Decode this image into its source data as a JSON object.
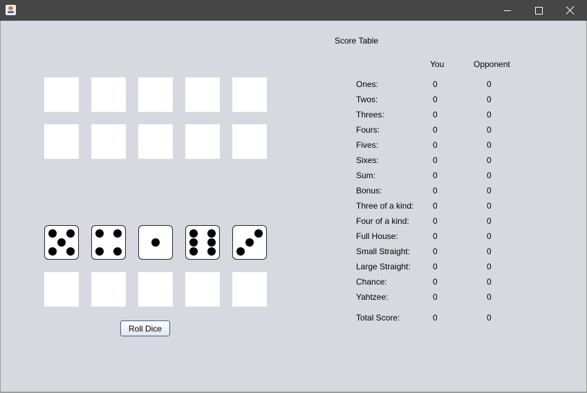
{
  "window": {
    "title": ""
  },
  "score_table": {
    "title": "Score Table",
    "col_you": "You",
    "col_opponent": "Opponent",
    "rows": [
      {
        "label": "Ones:",
        "you": "0",
        "opponent": "0"
      },
      {
        "label": "Twos:",
        "you": "0",
        "opponent": "0"
      },
      {
        "label": "Threes:",
        "you": "0",
        "opponent": "0"
      },
      {
        "label": "Fours:",
        "you": "0",
        "opponent": "0"
      },
      {
        "label": "Fives:",
        "you": "0",
        "opponent": "0"
      },
      {
        "label": "Sixes:",
        "you": "0",
        "opponent": "0"
      },
      {
        "label": "Sum:",
        "you": "0",
        "opponent": "0"
      },
      {
        "label": "Bonus:",
        "you": "0",
        "opponent": "0"
      },
      {
        "label": "Three of a kind:",
        "you": "0",
        "opponent": "0"
      },
      {
        "label": "Four of a kind:",
        "you": "0",
        "opponent": "0"
      },
      {
        "label": "Full House:",
        "you": "0",
        "opponent": "0"
      },
      {
        "label": "Small Straight:",
        "you": "0",
        "opponent": "0"
      },
      {
        "label": "Large Straight:",
        "you": "0",
        "opponent": "0"
      },
      {
        "label": "Chance:",
        "you": "0",
        "opponent": "0"
      },
      {
        "label": "Yahtzee:",
        "you": "0",
        "opponent": "0"
      }
    ],
    "total": {
      "label": "Total Score:",
      "you": "0",
      "opponent": "0"
    }
  },
  "dice": [
    5,
    4,
    1,
    6,
    3
  ],
  "roll_button_label": "Roll Dice"
}
